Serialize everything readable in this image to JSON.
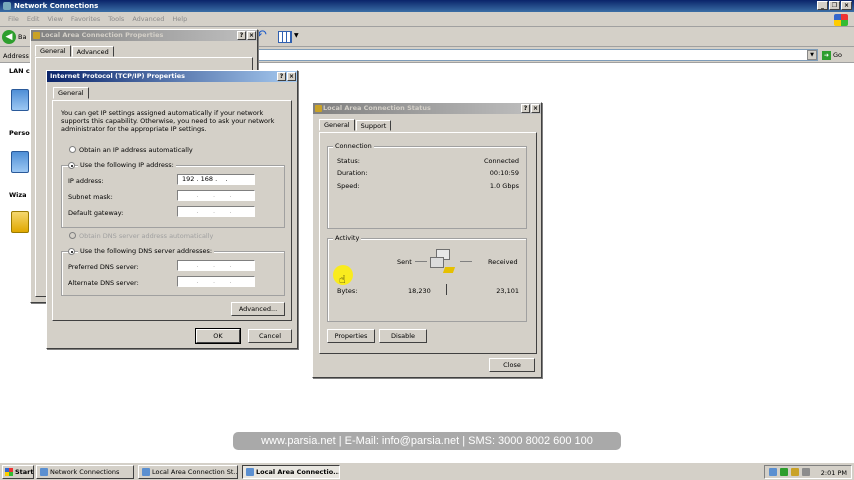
{
  "explorer": {
    "title": "Network Connections",
    "menu": [
      "File",
      "Edit",
      "View",
      "Favorites",
      "Tools",
      "Advanced",
      "Help"
    ],
    "back_label": "Ba",
    "address_label": "Address",
    "go_label": "Go",
    "left_pane": {
      "section1": "LAN c",
      "section2": "Perso",
      "section3": "Wiza"
    }
  },
  "lac_properties": {
    "title": "Local Area Connection Properties",
    "tabs": [
      "General",
      "Advanced"
    ]
  },
  "tcpip": {
    "title": "Internet Protocol (TCP/IP) Properties",
    "tab": "General",
    "description": "You can get IP settings assigned automatically if your network supports this capability. Otherwise, you need to ask your network administrator for the appropriate IP settings.",
    "radio_auto_ip": "Obtain an IP address automatically",
    "radio_manual_ip": "Use the following IP address:",
    "ip_label": "IP address:",
    "ip_value": "192 . 168 .    .",
    "subnet_label": "Subnet mask:",
    "subnet_value": "       .       .       .",
    "gateway_label": "Default gateway:",
    "gateway_value": "       .       .       .",
    "radio_auto_dns": "Obtain DNS server address automatically",
    "radio_manual_dns": "Use the following DNS server addresses:",
    "preferred_dns_label": "Preferred DNS server:",
    "preferred_dns_value": "       .       .       .",
    "alternate_dns_label": "Alternate DNS server:",
    "alternate_dns_value": "       .       .       .",
    "advanced_button": "Advanced...",
    "ok_button": "OK",
    "cancel_button": "Cancel"
  },
  "status": {
    "title": "Local Area Connection Status",
    "tabs": [
      "General",
      "Support"
    ],
    "connection_group": "Connection",
    "status_label": "Status:",
    "status_value": "Connected",
    "duration_label": "Duration:",
    "duration_value": "00:10:59",
    "speed_label": "Speed:",
    "speed_value": "1.0 Gbps",
    "activity_group": "Activity",
    "sent_label": "Sent",
    "received_label": "Received",
    "bytes_label": "Bytes:",
    "bytes_sent": "18,230",
    "bytes_received": "23,101",
    "properties_button": "Properties",
    "disable_button": "Disable",
    "close_button": "Close"
  },
  "watermark": "www.parsia.net | E-Mail: info@parsia.net | SMS: 3000 8002 600 100",
  "taskbar": {
    "start": "Start",
    "tasks": [
      "Network Connections",
      "Local Area Connection St...",
      "Local Area Connectio..."
    ],
    "clock": "2:01 PM"
  }
}
